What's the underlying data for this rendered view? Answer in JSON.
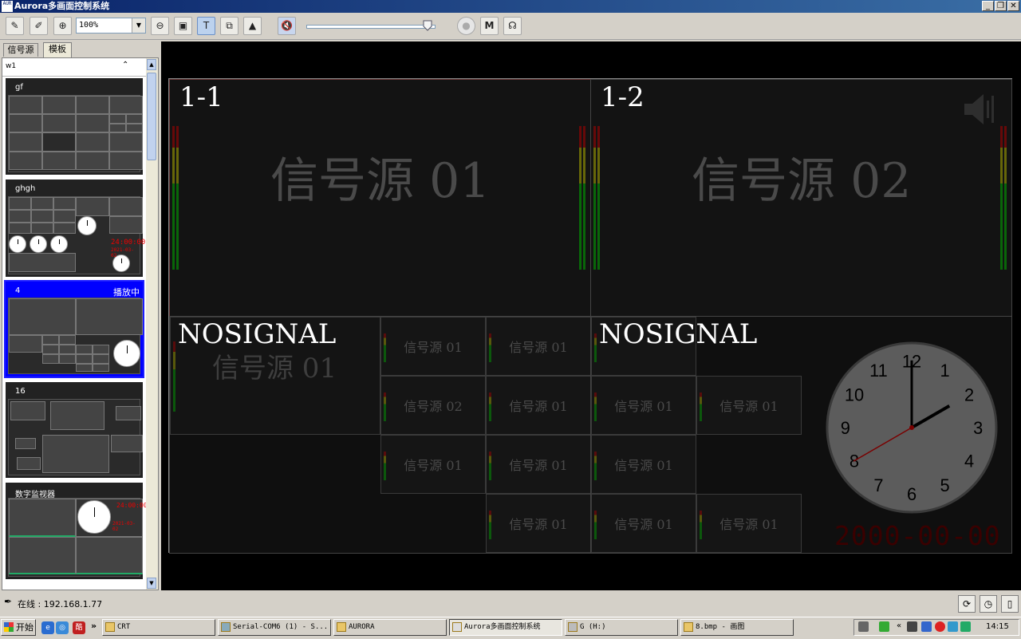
{
  "window": {
    "title": "Aurora多画面控制系统",
    "icon_text": "AUR"
  },
  "toolbar": {
    "zoom_value": "100%",
    "m_label": "M",
    "volume_level_percent": 95
  },
  "left_panel": {
    "tabs": [
      {
        "label": "信号源"
      },
      {
        "label": "模板"
      }
    ],
    "group_label": "w1",
    "templates": [
      {
        "name": "gf",
        "badge": ""
      },
      {
        "name": "ghgh",
        "badge": ""
      },
      {
        "name": "4",
        "badge": "播放中"
      },
      {
        "name": "16",
        "badge": ""
      },
      {
        "name": "数字监视器",
        "badge": ""
      }
    ],
    "mini_clock_text": "24:00:00",
    "mini_date_text": "2021-03-02"
  },
  "wall": {
    "windows": [
      {
        "label": "1-1",
        "source": "信号源 01"
      },
      {
        "label": "1-2",
        "source": "信号源 02"
      }
    ],
    "no_signal_label": "NOSIGNAL",
    "bottom_left_source": "信号源 01",
    "sub_windows_left": [
      "信号源 01",
      "信号源 01",
      "信号源 02",
      "信号源 01",
      "信号源 01",
      "信号源 01",
      "信号源 01"
    ],
    "sub_windows_right": [
      "信号源 01",
      "信号源 01",
      "信号源 01",
      "信号源 01",
      "信号源 01"
    ],
    "clock": {
      "hour": 2,
      "minute": 0,
      "second": 40
    },
    "clock_numbers": [
      "12",
      "1",
      "2",
      "3",
      "4",
      "5",
      "6",
      "7",
      "8",
      "9",
      "10",
      "11"
    ],
    "date_text": "2000-00-00"
  },
  "status": {
    "text": "在线 : 192.168.1.77"
  },
  "taskbar": {
    "start_label": "开始",
    "overflow": "»",
    "tasks": [
      {
        "label": "CRT"
      },
      {
        "label": "Serial-COM6 (1) - S..."
      },
      {
        "label": "AURORA"
      },
      {
        "label": "Aurora多画面控制系统"
      },
      {
        "label": "G (H:)"
      },
      {
        "label": "8.bmp - 画图"
      }
    ],
    "time": "14:15"
  },
  "colors": {
    "selected_template": "#0000ff",
    "date_red": "#3a0000",
    "titlebar": "#0a246a"
  }
}
